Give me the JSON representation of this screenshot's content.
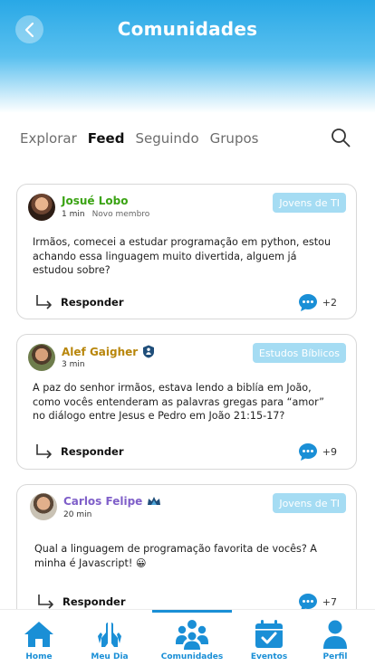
{
  "header": {
    "title": "Comunidades"
  },
  "tabs": [
    {
      "label": "Explorar",
      "active": false
    },
    {
      "label": "Feed",
      "active": true
    },
    {
      "label": "Seguindo",
      "active": false
    },
    {
      "label": "Grupos",
      "active": false
    }
  ],
  "posts": [
    {
      "author": "Josué Lobo",
      "author_color": "#3aa313",
      "time": "1 min",
      "subtitle": "Novo membro",
      "badge": "Jovens de TI",
      "text": "Irmãos, comecei a estudar programação em python, estou achando essa linguagem muito divertida, alguem já estudou sobre?",
      "reply_label": "Responder",
      "comment_count": "+2"
    },
    {
      "author": "Alef Gaigher",
      "author_color": "#b8860b",
      "time": "3 min",
      "badge": "Estudos Bíblicos",
      "text": "A paz do senhor irmãos, estava lendo a biblía em João, como vocês entenderam as palavras gregas para “amor” no diálogo entre Jesus e Pedro em João 21:15-17?",
      "reply_label": "Responder",
      "comment_count": "+9"
    },
    {
      "author": "Carlos Felipe",
      "author_color": "#7f5fc9",
      "time": "20 min",
      "badge": "Jovens de TI",
      "text": "Qual a linguagem de programação favorita de vocês? A minha é Javascript! 😀",
      "reply_label": "Responder",
      "comment_count": "+7"
    }
  ],
  "nav": [
    {
      "label": "Home",
      "icon": "home-icon"
    },
    {
      "label": "Meu Dia",
      "icon": "praying-hands-icon"
    },
    {
      "label": "Comunidades",
      "icon": "community-icon",
      "active": true
    },
    {
      "label": "Eventos",
      "icon": "calendar-check-icon"
    },
    {
      "label": "Perfil",
      "icon": "user-icon"
    }
  ],
  "colors": {
    "accent": "#1a8fd6",
    "badge": "#a5dcf3",
    "header": "#29a8e6"
  }
}
